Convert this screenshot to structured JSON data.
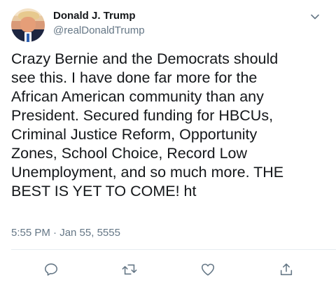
{
  "author": {
    "display_name": "Donald J. Trump",
    "handle": "@realDonaldTrump",
    "avatar_icon": "profile-photo"
  },
  "tweet": {
    "text": "Crazy Bernie and the Democrats should\nsee this. I have done far more for the\nAfrican American community than any\nPresident. Secured funding for HBCUs,\nCriminal Justice Reform, Opportunity\nZones, School Choice, Record Low\nUnemployment, and so much more. THE\nBEST IS YET TO COME! ht",
    "timestamp": "5:55 PM · Jan 55, 5555"
  },
  "actions": [
    {
      "icon": "reply-icon"
    },
    {
      "icon": "retweet-icon"
    },
    {
      "icon": "heart-icon"
    },
    {
      "icon": "share-icon"
    }
  ],
  "menu_icon": "chevron-down-icon",
  "colors": {
    "primary_text": "#14171a",
    "secondary_text": "#657786",
    "divider": "#e6ecf0"
  }
}
